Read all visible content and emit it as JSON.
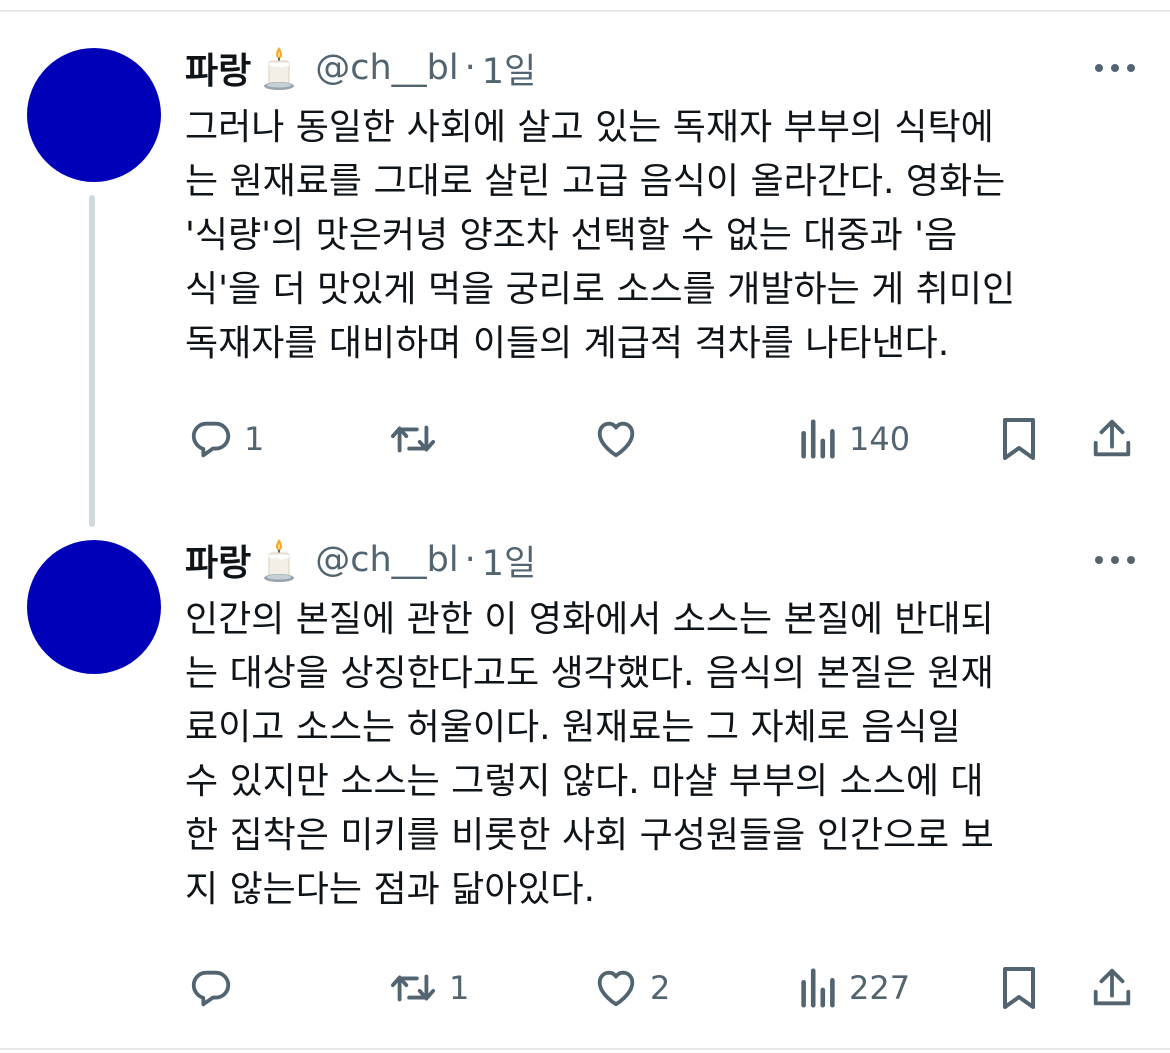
{
  "tweets": [
    {
      "author": {
        "display_name": "파랑",
        "badge_icon": "candle-icon",
        "handle": "@ch__bl",
        "separator": "·",
        "time": "1일",
        "avatar_color": "#0000b8"
      },
      "text_lines": [
        "그러나 동일한 사회에 살고 있는 독재자 부부의 식탁에",
        "는 원재료를 그대로 살린 고급 음식이 올라간다. 영화는",
        "'식량'의 맛은커녕 양조차 선택할 수 없는 대중과 '음",
        "식'을 더 맛있게 먹을 궁리로 소스를 개발하는 게 취미인",
        "독재자를 대비하며 이들의 계급적 격차를 나타낸다."
      ],
      "actions": {
        "reply_count": "1",
        "repost_count": "",
        "like_count": "",
        "views_count": "140"
      }
    },
    {
      "author": {
        "display_name": "파랑",
        "badge_icon": "candle-icon",
        "handle": "@ch__bl",
        "separator": "·",
        "time": "1일",
        "avatar_color": "#0000b8"
      },
      "text_lines": [
        "인간의 본질에 관한 이 영화에서 소스는 본질에 반대되",
        "는 대상을 상징한다고도 생각했다. 음식의 본질은 원재",
        "료이고 소스는 허울이다. 원재료는 그 자체로 음식일",
        "수 있지만 소스는 그렇지 않다. 마샬 부부의 소스에 대",
        "한 집착은 미키를 비롯한 사회 구성원들을 인간으로 보",
        "지 않는다는 점과 닮아있다."
      ],
      "actions": {
        "reply_count": "",
        "repost_count": "1",
        "like_count": "2",
        "views_count": "227"
      }
    }
  ],
  "icons": {
    "more": "more-horizontal-icon",
    "reply": "reply-icon",
    "repost": "repost-icon",
    "like": "heart-icon",
    "views": "views-icon",
    "bookmark": "bookmark-icon",
    "share": "share-icon"
  },
  "colors": {
    "text": "#0f1419",
    "secondary": "#536471",
    "thread_line": "#cfd9de",
    "divider": "#e7e9ea"
  }
}
